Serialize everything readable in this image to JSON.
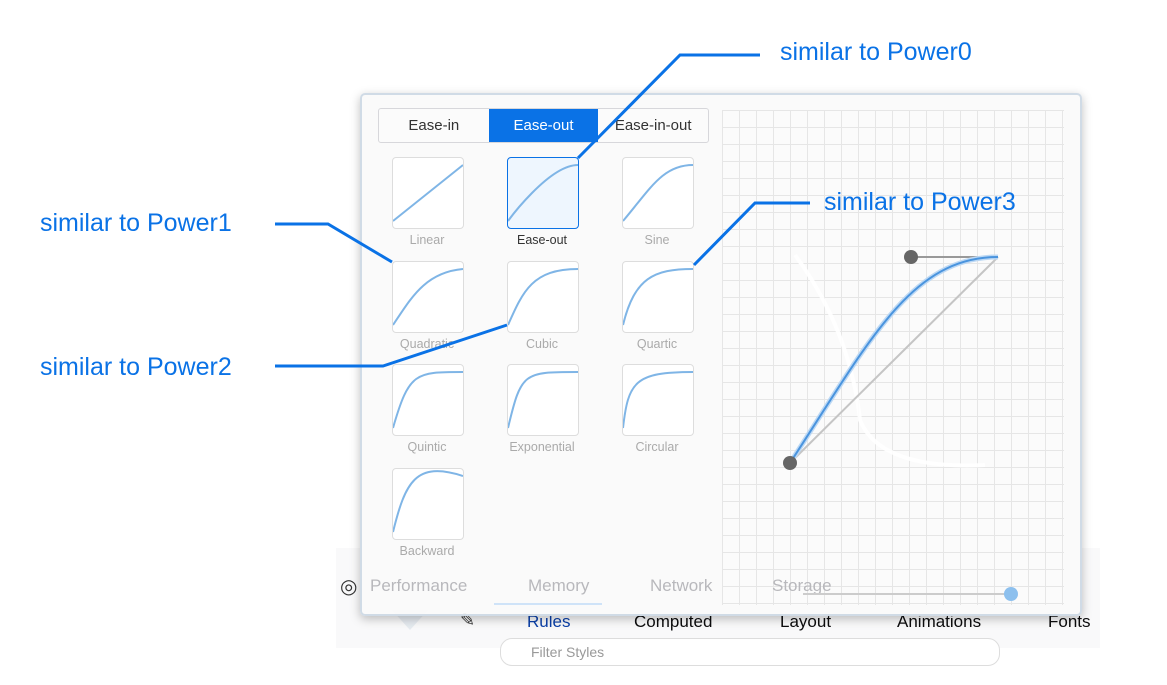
{
  "devtools": {
    "tabs": [
      "Performance",
      "Memory",
      "Network",
      "Storage"
    ],
    "subtabs": [
      "Rules",
      "Computed",
      "Layout",
      "Animations",
      "Fonts"
    ],
    "filter_placeholder": "Filter Styles"
  },
  "popup": {
    "tabs": [
      {
        "label": "Ease-in",
        "active": false
      },
      {
        "label": "Ease-out",
        "active": true
      },
      {
        "label": "Ease-in-out",
        "active": false
      }
    ],
    "presets": [
      {
        "label": "Linear",
        "selected": false
      },
      {
        "label": "Ease-out",
        "selected": true
      },
      {
        "label": "Sine",
        "selected": false
      },
      {
        "label": "Quadratic",
        "selected": false
      },
      {
        "label": "Cubic",
        "selected": false
      },
      {
        "label": "Quartic",
        "selected": false
      },
      {
        "label": "Quintic",
        "selected": false
      },
      {
        "label": "Exponential",
        "selected": false
      },
      {
        "label": "Circular",
        "selected": false
      },
      {
        "label": "Backward",
        "selected": false
      }
    ],
    "accent": "#0a72e6"
  },
  "annotations": [
    {
      "text": "similar to Power0"
    },
    {
      "text": "similar to Power1"
    },
    {
      "text": "similar to Power2"
    },
    {
      "text": "similar to Power3"
    }
  ]
}
